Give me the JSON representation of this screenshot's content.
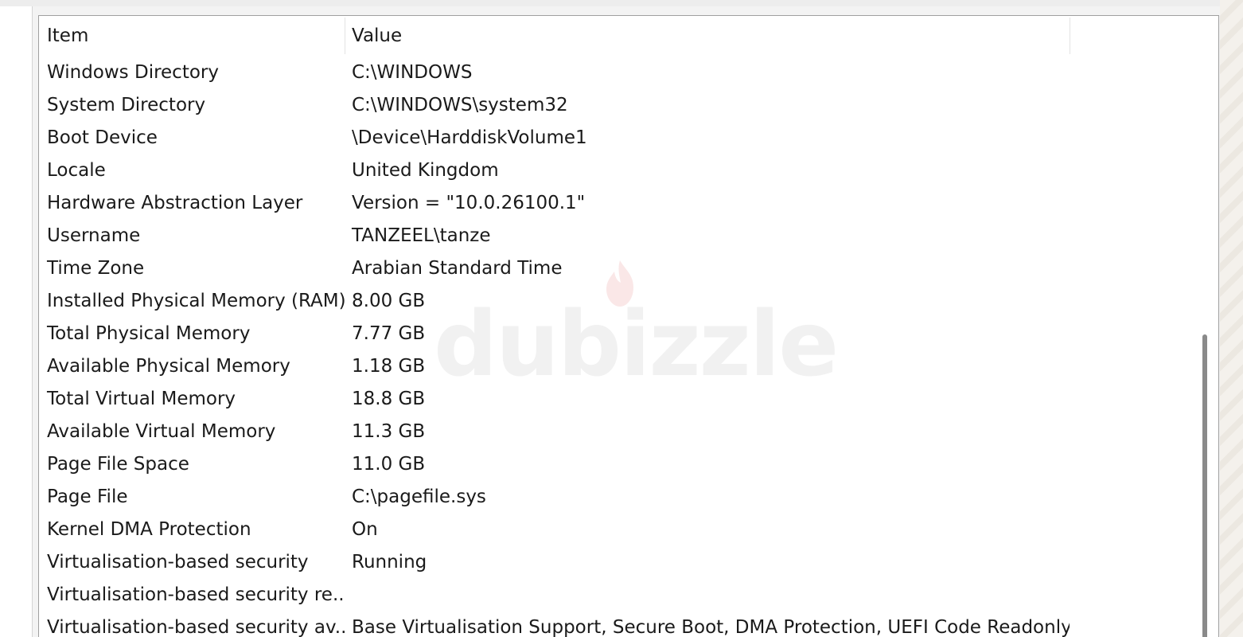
{
  "columns": {
    "item": "Item",
    "value": "Value"
  },
  "rows": [
    {
      "item": "Windows Directory",
      "value": "C:\\WINDOWS"
    },
    {
      "item": "System Directory",
      "value": "C:\\WINDOWS\\system32"
    },
    {
      "item": "Boot Device",
      "value": "\\Device\\HarddiskVolume1"
    },
    {
      "item": "Locale",
      "value": "United Kingdom"
    },
    {
      "item": "Hardware Abstraction Layer",
      "value": "Version = \"10.0.26100.1\""
    },
    {
      "item": "Username",
      "value": "TANZEEL\\tanze"
    },
    {
      "item": "Time Zone",
      "value": "Arabian Standard Time"
    },
    {
      "item": "Installed Physical Memory (RAM)",
      "value": "8.00 GB"
    },
    {
      "item": "Total Physical Memory",
      "value": "7.77 GB"
    },
    {
      "item": "Available Physical Memory",
      "value": "1.18 GB"
    },
    {
      "item": "Total Virtual Memory",
      "value": "18.8 GB"
    },
    {
      "item": "Available Virtual Memory",
      "value": "11.3 GB"
    },
    {
      "item": "Page File Space",
      "value": "11.0 GB"
    },
    {
      "item": "Page File",
      "value": "C:\\pagefile.sys"
    },
    {
      "item": "Kernel DMA Protection",
      "value": "On"
    },
    {
      "item": "Virtualisation-based security",
      "value": "Running"
    },
    {
      "item": "Virtualisation-based security re...",
      "value": ""
    },
    {
      "item": "Virtualisation-based security av...",
      "value": "Base Virtualisation Support, Secure Boot, DMA Protection, UEFI Code Readonly,..."
    }
  ],
  "watermark": {
    "text": "dubizzle"
  },
  "colors": {
    "text": "#1a1a1a",
    "border": "#a0a0a0",
    "scrollbar_thumb": "#8a8a8a",
    "watermark": "#bebebe"
  }
}
